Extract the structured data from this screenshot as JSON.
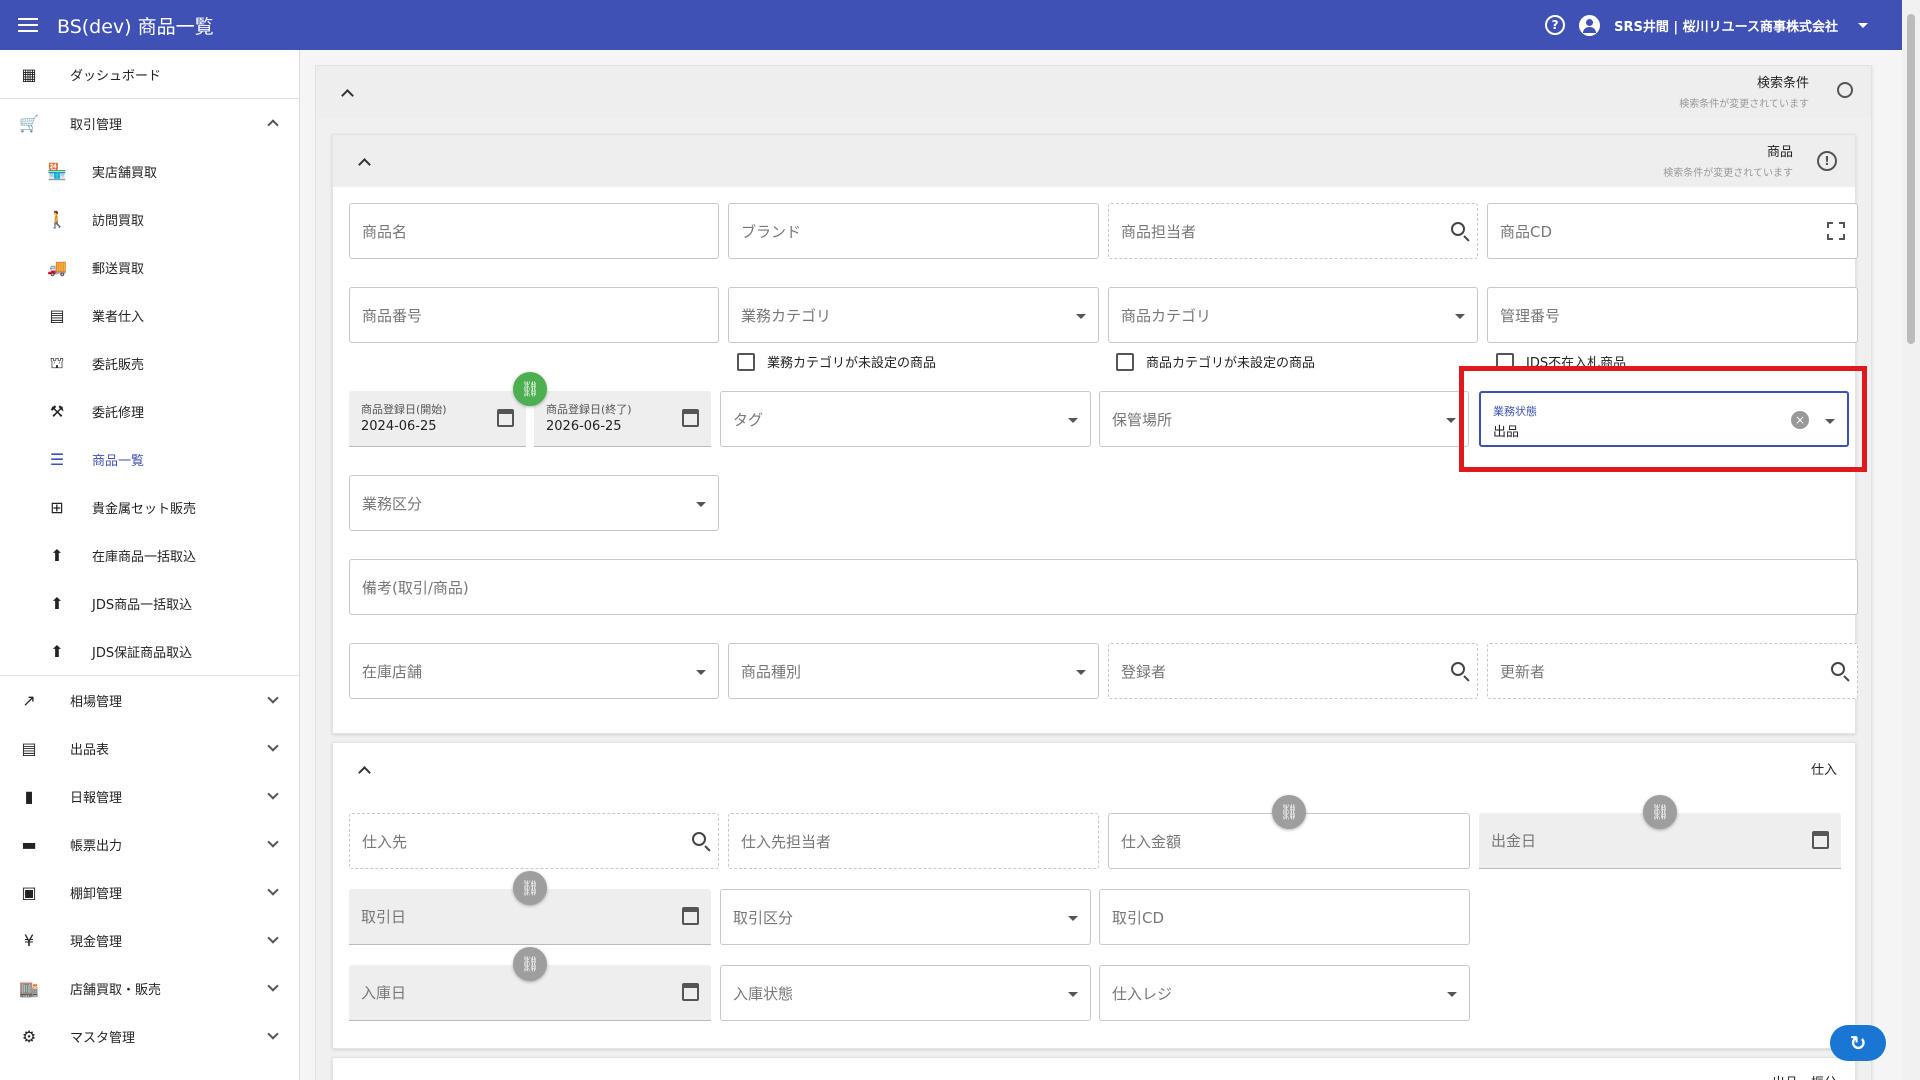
{
  "header": {
    "title": "BS(dev) 商品一覧",
    "help_icon": "help-circle-icon",
    "user": "SRS井間 | 桜川リユース商事株式会社"
  },
  "sidebar": {
    "top": [
      {
        "label": "ダッシュボード",
        "icon": "dashboard-icon"
      },
      {
        "label": "取引管理",
        "icon": "cart-icon"
      }
    ],
    "sub": [
      {
        "label": "実店舗買取",
        "icon": "store-icon"
      },
      {
        "label": "訪問買取",
        "icon": "walk-icon"
      },
      {
        "label": "郵送買取",
        "icon": "truck-icon"
      },
      {
        "label": "業者仕入",
        "icon": "building-icon"
      },
      {
        "label": "委託販売",
        "icon": "stamp-icon"
      },
      {
        "label": "委託修理",
        "icon": "tools-icon"
      },
      {
        "label": "商品一覧",
        "icon": "list-icon"
      },
      {
        "label": "貴金属セット販売",
        "icon": "grid-icon"
      },
      {
        "label": "在庫商品一括取込",
        "icon": "upload-icon"
      },
      {
        "label": "JDS商品一括取込",
        "icon": "upload-icon"
      },
      {
        "label": "JDS保証商品取込",
        "icon": "upload-icon"
      }
    ],
    "groups": [
      {
        "label": "相場管理",
        "icon": "trend-icon"
      },
      {
        "label": "出品表",
        "icon": "sheet-icon"
      },
      {
        "label": "日報管理",
        "icon": "doc-icon"
      },
      {
        "label": "帳票出力",
        "icon": "note-icon"
      },
      {
        "label": "棚卸管理",
        "icon": "archive-icon"
      },
      {
        "label": "現金管理",
        "icon": "yen-icon"
      },
      {
        "label": "店舗買取・販売",
        "icon": "shop-icon"
      },
      {
        "label": "マスタ管理",
        "icon": "gear-icon"
      }
    ]
  },
  "search": {
    "title": "検索条件",
    "subtitle": "検索条件が変更されています"
  },
  "product": {
    "title": "商品",
    "subtitle": "検索条件が変更されています",
    "fields": {
      "name": "商品名",
      "brand": "ブランド",
      "staff": "商品担当者",
      "cd": "商品CD",
      "number": "商品番号",
      "biz_category": "業務カテゴリ",
      "category": "商品カテゴリ",
      "manage_no": "管理番号",
      "reg_start_label": "商品登録日(開始)",
      "reg_start": "2024-06-25",
      "reg_end_label": "商品登録日(終了)",
      "reg_end": "2026-06-25",
      "tag": "タグ",
      "storage": "保管場所",
      "status_label": "業務状態",
      "status_value": "出品",
      "biz_type": "業務区分",
      "note": "備考(取引/商品)",
      "stock_store": "在庫店舗",
      "product_type": "商品種別",
      "registrant": "登録者",
      "updater": "更新者"
    },
    "checks": [
      "業務カテゴリが未設定の商品",
      "商品カテゴリが未設定の商品",
      "JDS不在入札商品"
    ]
  },
  "purchase": {
    "title": "仕入",
    "fields": {
      "supplier": "仕入先",
      "supplier_staff": "仕入先担当者",
      "amount": "仕入金額",
      "pay_date": "出金日",
      "trade_date": "取引日",
      "trade_type": "取引区分",
      "trade_cd": "取引CD",
      "in_date": "入庫日",
      "in_state": "入庫状態",
      "register": "仕入レジ"
    }
  },
  "listing": {
    "title": "出品・振分"
  }
}
